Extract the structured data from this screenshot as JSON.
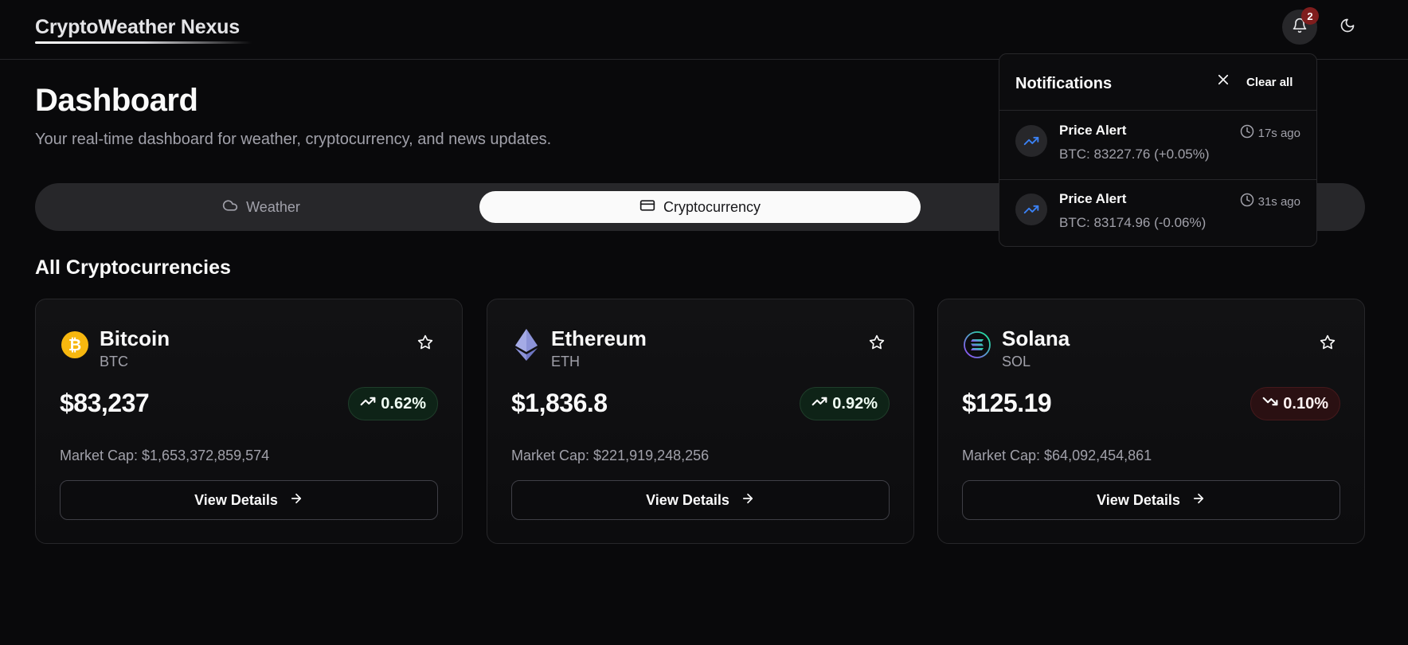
{
  "app": {
    "title": "CryptoWeather Nexus",
    "notification_count": "2",
    "icons": {
      "bell": "bell-icon",
      "theme": "moon-icon"
    }
  },
  "page": {
    "title": "Dashboard",
    "subtitle": "Your real-time dashboard for weather, cryptocurrency, and news updates."
  },
  "tabs": [
    {
      "label": "Weather",
      "icon": "cloud-icon",
      "active": false
    },
    {
      "label": "Cryptocurrency",
      "icon": "credit-card-icon",
      "active": true
    }
  ],
  "section_title": "All Cryptocurrencies",
  "coins": [
    {
      "name": "Bitcoin",
      "symbol": "BTC",
      "price": "$83,237",
      "change": "0.62%",
      "direction": "up",
      "market_cap": "Market Cap: $1,653,372,859,574",
      "button_label": "View Details",
      "logo_color": "#f7b70f",
      "logo_icon": "bitcoin-logo-icon"
    },
    {
      "name": "Ethereum",
      "symbol": "ETH",
      "price": "$1,836.8",
      "change": "0.92%",
      "direction": "up",
      "market_cap": "Market Cap: $221,919,248,256",
      "button_label": "View Details",
      "logo_color": "#8c93d8",
      "logo_icon": "ethereum-logo-icon"
    },
    {
      "name": "Solana",
      "symbol": "SOL",
      "price": "$125.19",
      "change": "0.10%",
      "direction": "down",
      "market_cap": "Market Cap: $64,092,454,861",
      "button_label": "View Details",
      "logo_color": "#9945ff",
      "logo_icon": "solana-logo-icon"
    }
  ],
  "notifications": {
    "title": "Notifications",
    "clear_label": "Clear all",
    "items": [
      {
        "title": "Price Alert",
        "message": "BTC: 83227.76 (+0.05%)",
        "time": "17s ago"
      },
      {
        "title": "Price Alert",
        "message": "BTC: 83174.96 (-0.06%)",
        "time": "31s ago"
      }
    ]
  },
  "colors": {
    "background": "#09090b",
    "up_accent": "#0e2317",
    "down_accent": "#2a1012",
    "badge": "#7f1d1d",
    "trend_icon": "#3b82f6"
  }
}
